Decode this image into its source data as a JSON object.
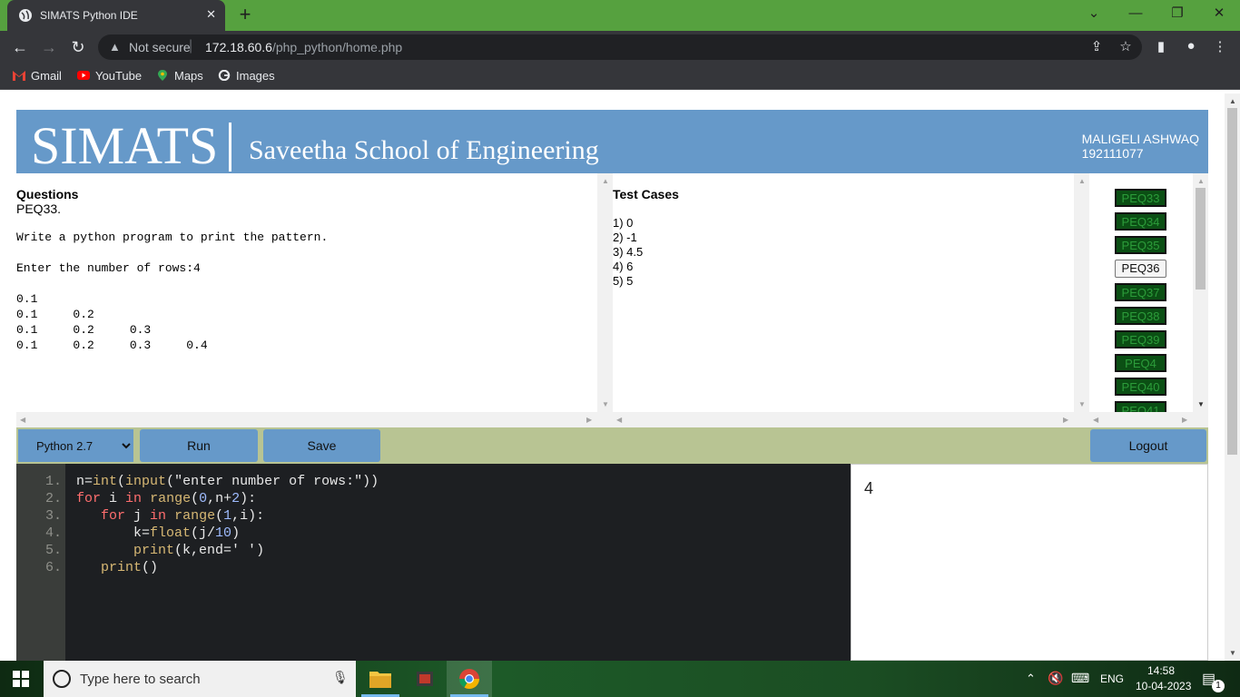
{
  "browser": {
    "tab_title": "SIMATS Python IDE",
    "new_tab": "+",
    "security": "Not secure",
    "url_host": "172.18.60.6",
    "url_path": "/php_python/home.php",
    "bookmarks": [
      "Gmail",
      "YouTube",
      "Maps",
      "Images"
    ]
  },
  "header": {
    "logo": "SIMATS",
    "school": "Saveetha School of Engineering",
    "student_name": "MALIGELI ASHWAQ",
    "student_id": "192111077"
  },
  "questions": {
    "heading": "Questions",
    "id": "PEQ33.",
    "text": "Write a python program to print the pattern.\n\nEnter the number of rows:4\n\n0.1\n0.1     0.2\n0.1     0.2     0.3\n0.1     0.2     0.3     0.4"
  },
  "test_cases": {
    "heading": "Test Cases",
    "items": [
      "1) 0",
      "2) -1",
      "3) 4.5",
      "4) 6",
      "5) 5"
    ]
  },
  "problem_list": [
    {
      "label": "PEQ33",
      "active": false
    },
    {
      "label": "PEQ34",
      "active": false
    },
    {
      "label": "PEQ35",
      "active": false
    },
    {
      "label": "PEQ36",
      "active": true
    },
    {
      "label": "PEQ37",
      "active": false
    },
    {
      "label": "PEQ38",
      "active": false
    },
    {
      "label": "PEQ39",
      "active": false
    },
    {
      "label": "PEQ4",
      "active": false
    },
    {
      "label": "PEQ40",
      "active": false
    },
    {
      "label": "PEQ41",
      "active": false
    }
  ],
  "controls": {
    "language": "Python 2.7",
    "run": "Run",
    "save": "Save",
    "logout": "Logout"
  },
  "editor": {
    "line_numbers": [
      "1.",
      "2.",
      "3.",
      "4.",
      "5.",
      "6."
    ]
  },
  "output": {
    "text": "4"
  },
  "taskbar": {
    "search_placeholder": "Type here to search",
    "language": "ENG",
    "time": "14:58",
    "date": "10-04-2023",
    "notifications": "1"
  }
}
